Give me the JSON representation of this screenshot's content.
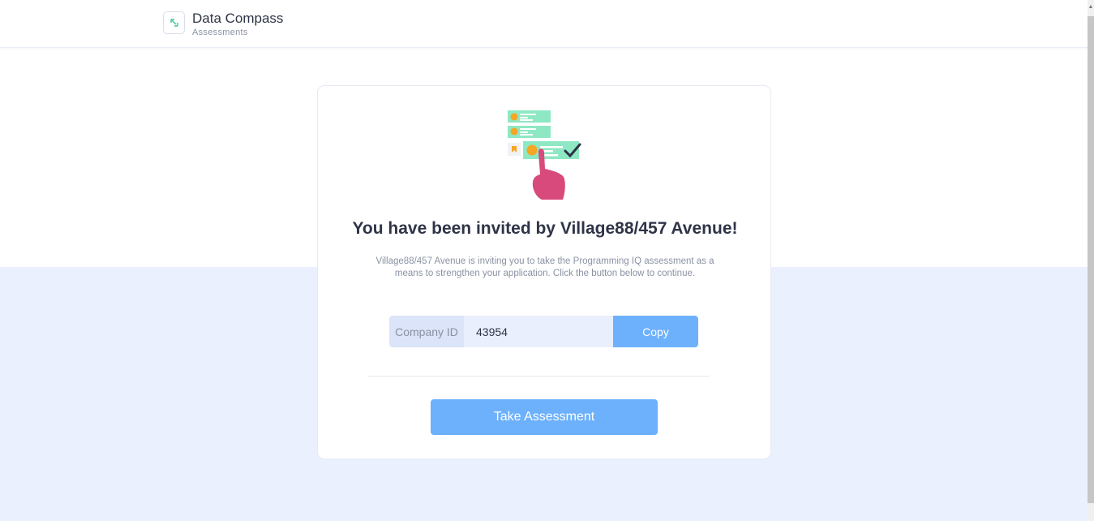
{
  "header": {
    "app_title": "Data Compass",
    "app_subtitle": "Assessments",
    "logo_icon": "compass-arrows-icon"
  },
  "colors": {
    "accent": "#6db1fc",
    "band": "#eaf0fd",
    "title": "#2f3447",
    "muted": "#8a92a3",
    "illustration_green": "#8ee8c4",
    "illustration_orange": "#f5a623",
    "illustration_hand": "#d84a7b"
  },
  "invite": {
    "illustration_icon": "checklist-hand-illustration",
    "title": "You have been invited by Village88/457 Avenue!",
    "body": "Village88/457 Avenue is inviting you to take the Programming IQ assessment as a means to strengthen your application. Click the button below to continue."
  },
  "company": {
    "label": "Company ID",
    "value": "43954",
    "copy_label": "Copy"
  },
  "actions": {
    "take_assessment_label": "Take Assessment"
  }
}
